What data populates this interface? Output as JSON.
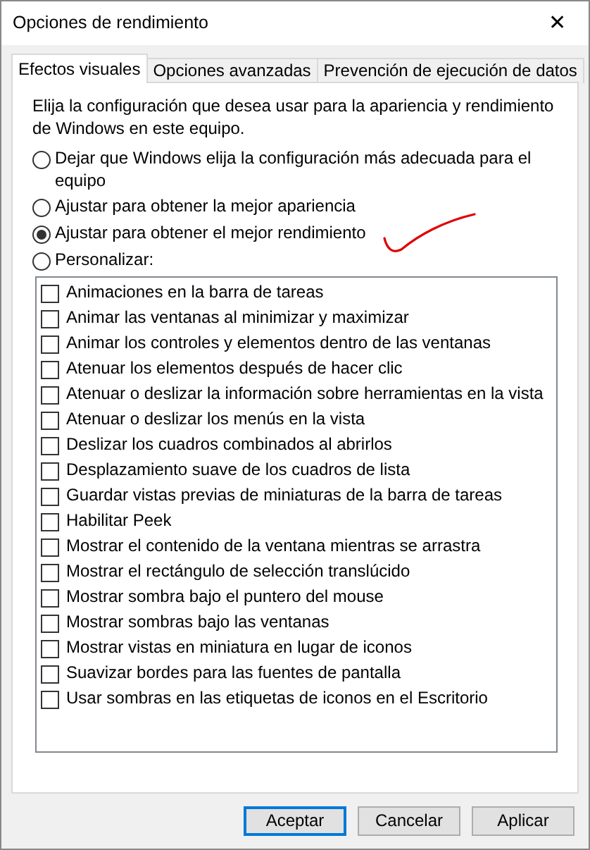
{
  "window": {
    "title": "Opciones de rendimiento",
    "close": "✕"
  },
  "tabs": [
    {
      "label": "Efectos visuales",
      "selected": true
    },
    {
      "label": "Opciones avanzadas",
      "selected": false
    },
    {
      "label": "Prevención de ejecución de datos",
      "selected": false
    }
  ],
  "intro": "Elija la configuración que desea usar para la apariencia y rendimiento de Windows en este equipo.",
  "radios": [
    {
      "label": "Dejar que Windows elija la configuración más adecuada para el equipo",
      "selected": false
    },
    {
      "label": "Ajustar para obtener la mejor apariencia",
      "selected": false
    },
    {
      "label": "Ajustar para obtener el mejor rendimiento",
      "selected": true
    },
    {
      "label": "Personalizar:",
      "selected": false
    }
  ],
  "effects": [
    {
      "label": "Animaciones en la barra de tareas",
      "checked": false
    },
    {
      "label": "Animar las ventanas al minimizar y maximizar",
      "checked": false
    },
    {
      "label": "Animar los controles y elementos dentro de las ventanas",
      "checked": false
    },
    {
      "label": "Atenuar los elementos después de hacer clic",
      "checked": false
    },
    {
      "label": "Atenuar o deslizar la información sobre herramientas en la vista",
      "checked": false
    },
    {
      "label": "Atenuar o deslizar los menús en la vista",
      "checked": false
    },
    {
      "label": "Deslizar los cuadros combinados al abrirlos",
      "checked": false
    },
    {
      "label": "Desplazamiento suave de los cuadros de lista",
      "checked": false
    },
    {
      "label": "Guardar vistas previas de miniaturas de la barra de tareas",
      "checked": false
    },
    {
      "label": "Habilitar Peek",
      "checked": false
    },
    {
      "label": "Mostrar el contenido de la ventana mientras se arrastra",
      "checked": false
    },
    {
      "label": "Mostrar el rectángulo de selección translúcido",
      "checked": false
    },
    {
      "label": "Mostrar sombra bajo el puntero del mouse",
      "checked": false
    },
    {
      "label": "Mostrar sombras bajo las ventanas",
      "checked": false
    },
    {
      "label": "Mostrar vistas en miniatura en lugar de iconos",
      "checked": false
    },
    {
      "label": "Suavizar bordes para las fuentes de pantalla",
      "checked": false
    },
    {
      "label": "Usar sombras en las etiquetas de iconos en el Escritorio",
      "checked": false
    }
  ],
  "buttons": [
    {
      "label": "Aceptar",
      "default": true
    },
    {
      "label": "Cancelar",
      "default": false
    },
    {
      "label": "Aplicar",
      "default": false
    }
  ]
}
